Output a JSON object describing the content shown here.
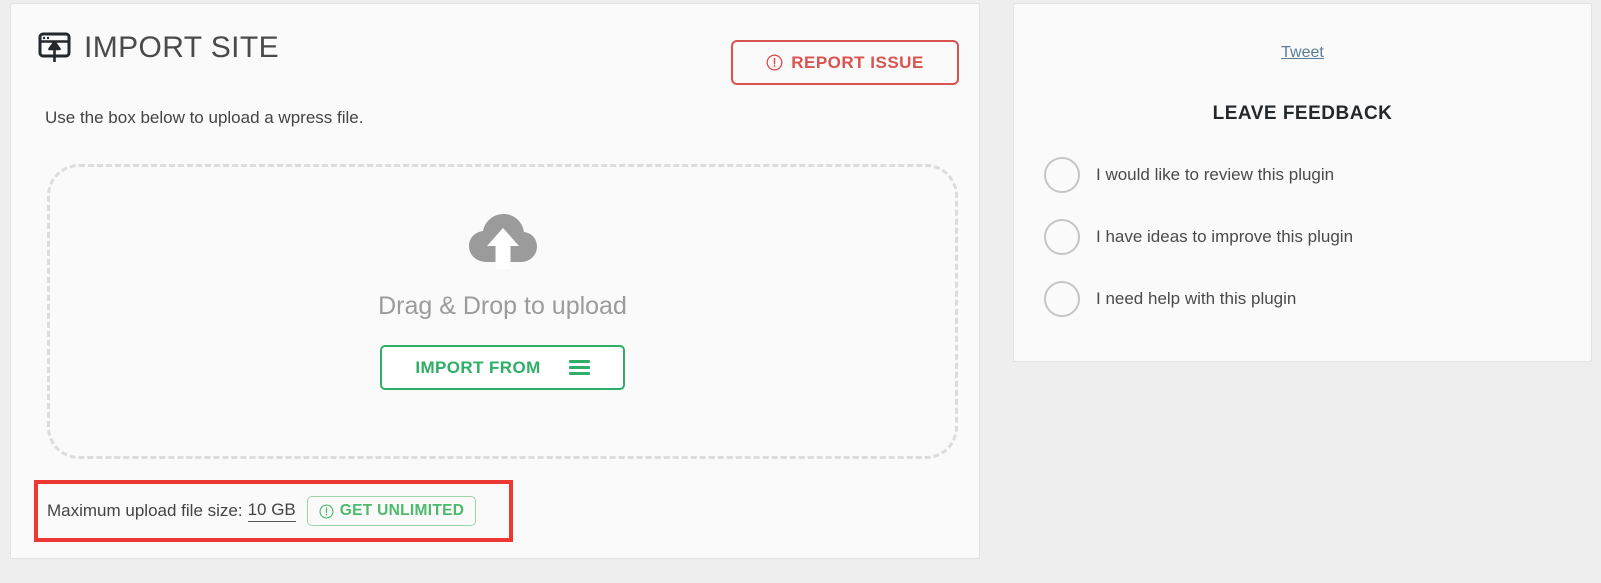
{
  "import_card": {
    "title": "IMPORT SITE",
    "title_icon": "import-site-icon",
    "report_issue": {
      "label": "REPORT ISSUE",
      "icon": "exclamation-circle-icon",
      "color": "#d9534f"
    },
    "instructions": "Use the box below to upload a wpress file.",
    "drop_zone": {
      "icon": "cloud-upload-icon",
      "label": "Drag & Drop to upload",
      "button_label": "IMPORT FROM",
      "button_icon": "hamburger-menu-icon",
      "button_color": "#2eae66"
    },
    "max_upload": {
      "label": "Maximum upload file size:",
      "value": "10 GB",
      "get_unlimited_label": "GET UNLIMITED",
      "get_unlimited_icon": "exclamation-circle-icon",
      "get_unlimited_color": "#4cb96b",
      "highlight_color": "#ed3833"
    }
  },
  "feedback_card": {
    "tweet_link": "Tweet",
    "title": "LEAVE FEEDBACK",
    "options": [
      {
        "label": "I would like to review this plugin",
        "selected": false
      },
      {
        "label": "I have ideas to improve this plugin",
        "selected": false
      },
      {
        "label": "I need help with this plugin",
        "selected": false
      }
    ]
  }
}
